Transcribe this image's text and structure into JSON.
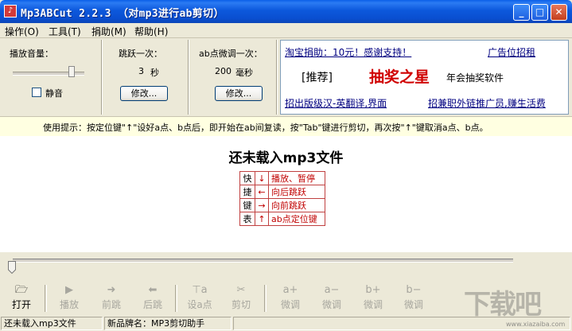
{
  "window": {
    "title": "Mp3ABCut  2.2.3 （对mp3进行ab剪切）",
    "buttons": {
      "minimize": "_",
      "maximize": "□",
      "close": "✕"
    }
  },
  "menu": [
    {
      "label": "操作(O)"
    },
    {
      "label": "工具(T)"
    },
    {
      "label": "捐助(M)"
    },
    {
      "label": "帮助(H)"
    }
  ],
  "volume": {
    "label": "播放音量：",
    "level": 0.85,
    "mute_label": "静音",
    "muted": false
  },
  "jump": {
    "label": "跳跃一次：",
    "value": "3",
    "unit": "秒",
    "button": "修改..."
  },
  "fine": {
    "label": "ab点微调一次：",
    "value": "200",
    "unit": "毫秒",
    "button": "修改..."
  },
  "ad": {
    "donate_link": "淘宝捐助：10元！感谢支持！",
    "ad_rent": "广告位招租",
    "recommend": "[推荐]",
    "lottery_big": "抽奖之星",
    "lottery_small": "年会抽奖软件",
    "translate_link": "招出版级汉-英翻译,界面",
    "parttime_link": "招兼职外链推广员,赚生活费"
  },
  "tip": "使用提示：按定位键\"↑\"设好a点、b点后，即开始在ab间复读，按\"Tab\"键进行剪切，再次按\"↑\"键取消a点、b点。",
  "main": {
    "status": "还未载入mp3文件",
    "shortcuts": {
      "chars": [
        "快",
        "捷",
        "键",
        "表"
      ],
      "rows": [
        {
          "arrow": "↓",
          "desc": "播放、暂停"
        },
        {
          "arrow": "←",
          "desc": "向后跳跃"
        },
        {
          "arrow": "→",
          "desc": "向前跳跃"
        },
        {
          "arrow": "↑",
          "desc": "ab点定位键"
        }
      ]
    }
  },
  "progress": {
    "position": 0.0
  },
  "toolbar": [
    {
      "icon": "open-folder-icon",
      "glyph": "🗁",
      "label": "打开",
      "enabled": true
    },
    {
      "icon": "play-icon",
      "glyph": "▶",
      "label": "播放",
      "enabled": false
    },
    {
      "icon": "forward-icon",
      "glyph": "➜",
      "label": "前跳",
      "enabled": false
    },
    {
      "icon": "back-icon",
      "glyph": "⬅",
      "label": "后跳",
      "enabled": false
    },
    {
      "icon": "set-a-icon",
      "glyph": "⊤a",
      "label": "设a点",
      "enabled": false
    },
    {
      "icon": "scissors-icon",
      "glyph": "✂",
      "label": "剪切",
      "enabled": false
    },
    {
      "icon": "a-plus-icon",
      "glyph": "a+",
      "label": "微调",
      "enabled": false
    },
    {
      "icon": "a-minus-icon",
      "glyph": "a−",
      "label": "微调",
      "enabled": false
    },
    {
      "icon": "b-plus-icon",
      "glyph": "b+",
      "label": "微调",
      "enabled": false
    },
    {
      "icon": "b-minus-icon",
      "glyph": "b−",
      "label": "微调",
      "enabled": false
    }
  ],
  "statusbar": {
    "left": "还未载入mp3文件",
    "right": "新品牌名：MP3剪切助手"
  },
  "watermark": {
    "text": "下载吧",
    "url": "www.xiazaiba.com"
  },
  "colors": {
    "title_blue": "#0a4fd0",
    "tip_bg": "#ffffe1",
    "accent_red": "#c00000",
    "link_blue": "#000080"
  }
}
